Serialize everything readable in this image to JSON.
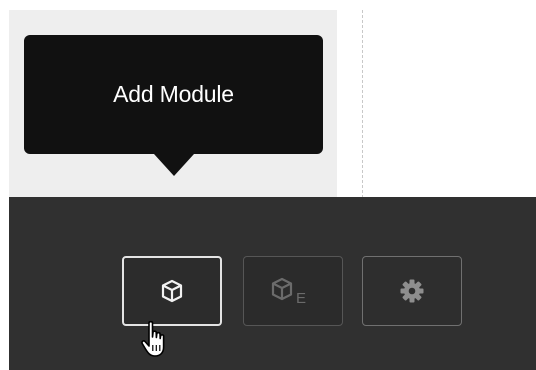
{
  "tooltip": {
    "text": "Add Module"
  },
  "toolbar": {
    "buttons": [
      {
        "name": "add-module",
        "icon": "cube-icon",
        "state": "active"
      },
      {
        "name": "add-module-extension",
        "icon": "cube-e-icon",
        "badge": "E",
        "state": "disabled"
      },
      {
        "name": "settings",
        "icon": "gear-icon",
        "state": "normal"
      }
    ]
  },
  "colors": {
    "tooltip_bg": "#111111",
    "toolbar_bg": "#303030",
    "panel_bg": "#eeeeee",
    "active_border": "#e4e4e4"
  }
}
